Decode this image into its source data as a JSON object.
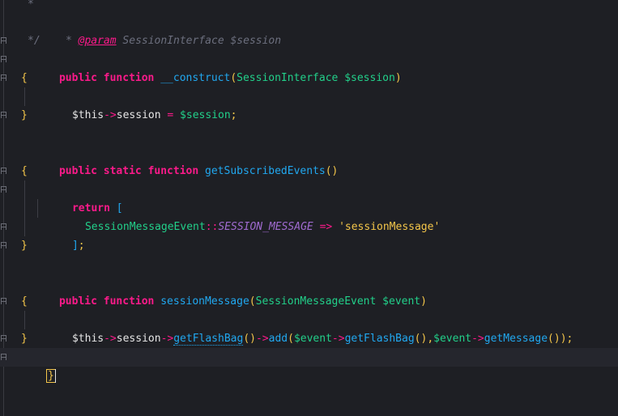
{
  "editor": {
    "theme_colors": {
      "background": "#1e1f24",
      "keyword": "#fc1a8a",
      "function": "#21a8f0",
      "type": "#22d08a",
      "string": "#f4c64a",
      "comment": "#6c6f7e",
      "constant": "#a06bd0"
    },
    "lines": {
      "l1": {
        "star": "*"
      },
      "l2": {
        "star": "* ",
        "tag": "@param",
        "text": " SessionInterface $session"
      },
      "l3": {
        "text": "*/"
      },
      "l4": {
        "kw1": "public",
        "kw2": "function",
        "name": "__construct",
        "p1": "(",
        "type": "SessionInterface",
        "var": "$session",
        "p2": ")"
      },
      "l5": {
        "brace": "{"
      },
      "l6": {
        "this": "$this",
        "arrow": "->",
        "prop": "session",
        "eq": "=",
        "var": "$session",
        "semi": ";"
      },
      "l7": {
        "brace": "}"
      },
      "l9": {
        "kw1": "public",
        "kw2": "static",
        "kw3": "function",
        "name": "getSubscribedEvents",
        "parens": "()"
      },
      "l10": {
        "brace": "{"
      },
      "l11": {
        "kw": "return",
        "bracket": "["
      },
      "l12": {
        "cls": "SessionMessageEvent",
        "dc": "::",
        "const": "SESSION_MESSAGE",
        "arrow": "=>",
        "str": "'sessionMessage'"
      },
      "l13": {
        "bracket": "]",
        "semi": ";"
      },
      "l14": {
        "brace": "}"
      },
      "l16": {
        "kw1": "public",
        "kw2": "function",
        "name": "sessionMessage",
        "p1": "(",
        "type": "SessionMessageEvent",
        "var": "$event",
        "p2": ")"
      },
      "l17": {
        "brace": "{"
      },
      "l18": {
        "this": "$this",
        "a1": "->",
        "prop": "session",
        "a2": "->",
        "m1": "getFlashBag",
        "pp1": "()",
        "a3": "->",
        "m2": "add",
        "p1": "(",
        "v1": "$event",
        "a4": "->",
        "m3": "getFlashBag",
        "pp2": "()",
        "comma": ",",
        "v2": "$event",
        "a5": "->",
        "m4": "getMessage",
        "pp3": "()",
        "p2": ")",
        "semi": ";"
      },
      "l19": {
        "brace": "}"
      },
      "l20": {
        "brace": "}"
      }
    }
  }
}
